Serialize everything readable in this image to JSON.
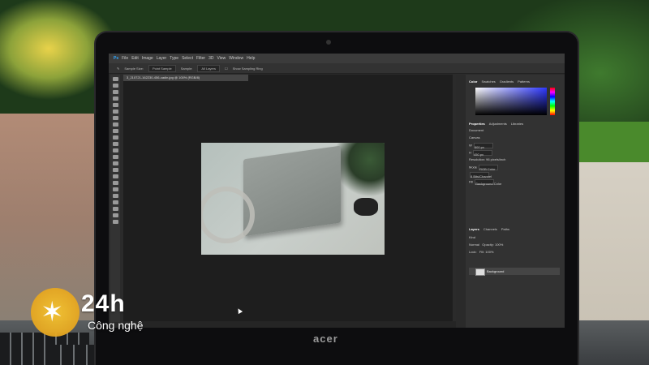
{
  "menu": {
    "app_icon": "Ps",
    "items": [
      "File",
      "Edit",
      "Image",
      "Layer",
      "Type",
      "Select",
      "Filter",
      "3D",
      "View",
      "Window",
      "Help"
    ]
  },
  "options_bar": {
    "sample_size_label": "Sample Size:",
    "sample_size_value": "Point Sample",
    "sample_label": "Sample:",
    "sample_value": "All Layers",
    "show_ring_label": "Show Sampling Ring"
  },
  "document": {
    "tab_title": "3_210721-162230-456-cadin.jpg @ 100% (RGB/8)",
    "zoom": "100%"
  },
  "panels": {
    "color_tabs": [
      "Color",
      "Swatches",
      "Gradients",
      "Patterns"
    ],
    "props_tabs": [
      "Properties",
      "Adjustments",
      "Libraries"
    ],
    "document_label": "Document",
    "canvas_label": "Canvas",
    "width": "800 px",
    "height": "450 px",
    "resolution": "Resolution: 96 pixels/inch",
    "mode_label": "Mode",
    "mode_value": "RGB Color",
    "depth_value": "8 Bits/Channel",
    "fill_label": "Fill",
    "fill_value": "Background Color",
    "layers_tabs": [
      "Layers",
      "Channels",
      "Paths"
    ],
    "kind_label": "Kind",
    "blend_mode": "Normal",
    "opacity": "Opacity: 100%",
    "lock_label": "Lock:",
    "fill_pct": "Fill: 100%",
    "layer_name": "Background"
  },
  "laptop_brand": "acer",
  "watermark": {
    "main": "24h",
    "sub": "Công nghệ"
  }
}
